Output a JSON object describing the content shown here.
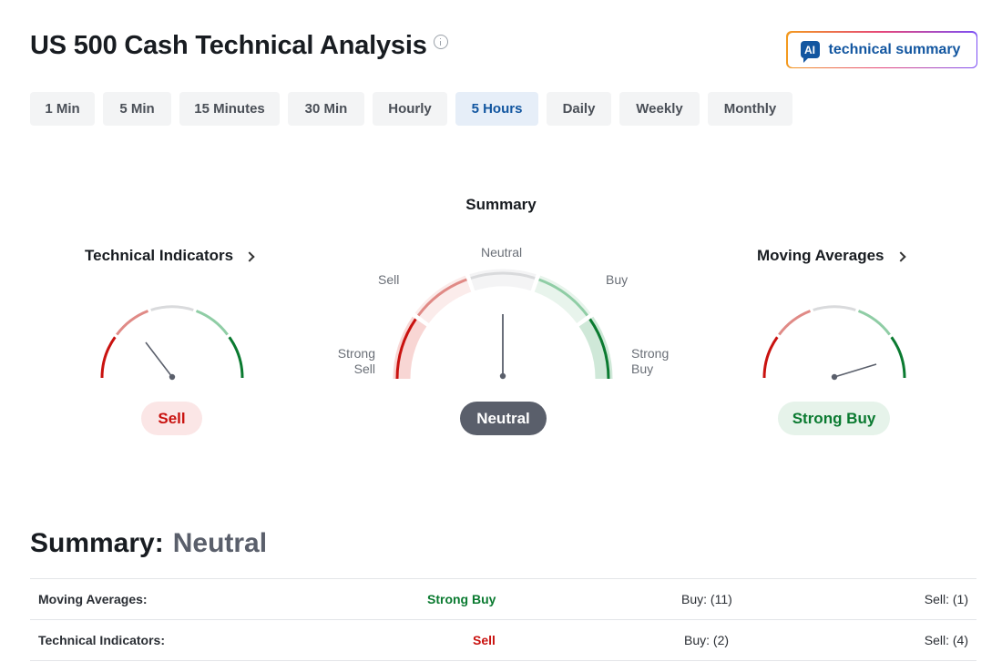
{
  "page": {
    "title": "US 500 Cash Technical Analysis"
  },
  "ai_button": {
    "badge": "AI",
    "label": "technical summary"
  },
  "timeframes": {
    "selected": "5 Hours",
    "items": [
      "1 Min",
      "5 Min",
      "15 Minutes",
      "30 Min",
      "Hourly",
      "5 Hours",
      "Daily",
      "Weekly",
      "Monthly"
    ]
  },
  "gauges": {
    "summary": {
      "title": "Summary",
      "result": "Neutral",
      "labels": {
        "neutral": "Neutral",
        "sell": "Sell",
        "buy": "Buy",
        "strong_sell_1": "Strong",
        "strong_sell_2": "Sell",
        "strong_buy_1": "Strong",
        "strong_buy_2": "Buy"
      }
    },
    "technical_indicators": {
      "title": "Technical Indicators",
      "result": "Sell"
    },
    "moving_averages": {
      "title": "Moving Averages",
      "result": "Strong Buy"
    }
  },
  "colors": {
    "strong_sell": "#c9120f",
    "sell": "#e08a86",
    "neutral": "#d9dadc",
    "buy": "#8fcda5",
    "strong_buy": "#0a7a30"
  },
  "summary_table": {
    "heading": "Summary:",
    "value": "Neutral",
    "rows": [
      {
        "label": "Moving Averages:",
        "signal": "Strong Buy",
        "buy": "Buy: (11)",
        "sell": "Sell: (1)"
      },
      {
        "label": "Technical Indicators:",
        "signal": "Sell",
        "buy": "Buy: (2)",
        "sell": "Sell: (4)"
      }
    ]
  }
}
